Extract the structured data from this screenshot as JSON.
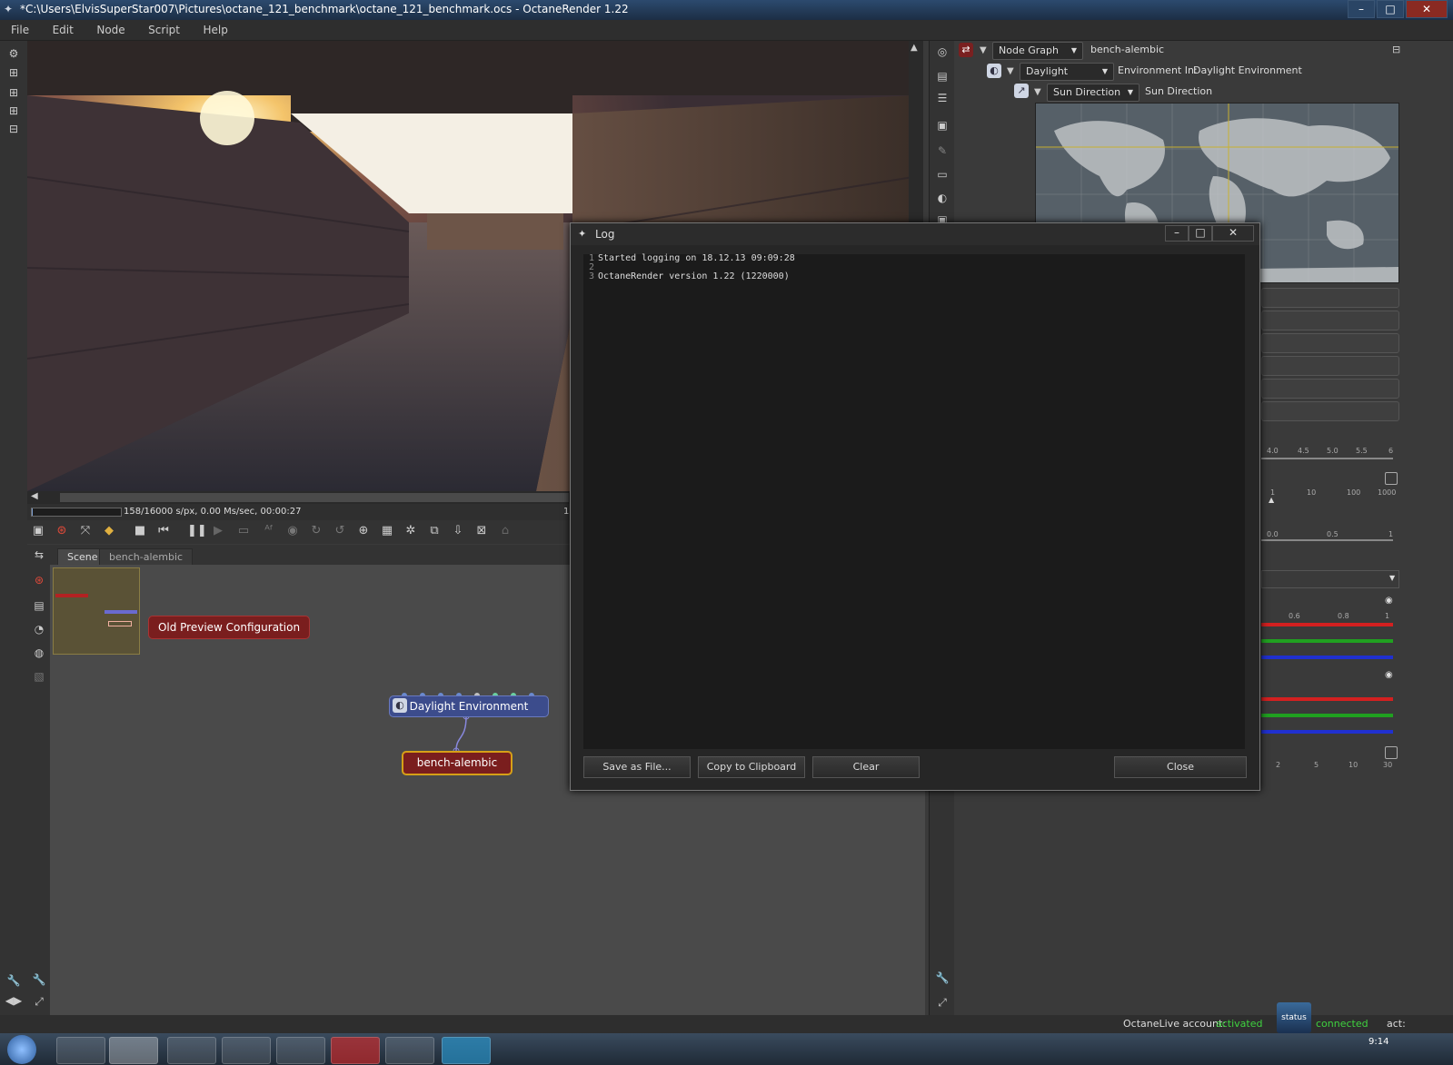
{
  "window": {
    "title": "*C:\\Users\\ElvisSuperStar007\\Pictures\\octane_121_benchmark\\octane_121_benchmark.ocs - OctaneRender 1.22",
    "min": "–",
    "max": "□",
    "close": "✕"
  },
  "menu": [
    "File",
    "Edit",
    "Node",
    "Script",
    "Help"
  ],
  "render_status": {
    "stats": "158/16000 s/px, 0.00 Ms/sec, 00:00:27",
    "progress_fraction": 0.0099,
    "right_marker": "1"
  },
  "node_graph": {
    "tabs": [
      "Scene",
      "bench-alembic"
    ],
    "nodes": {
      "old_preview": "Old Preview Configuration",
      "daylight": "Daylight Environment",
      "bench": "bench-alembic"
    }
  },
  "right_panel": {
    "header_combo": "Node Graph",
    "header_value": "bench-alembic",
    "env_combo": "Daylight",
    "env_label": "Environment In:",
    "env_value": "Daylight Environment",
    "sun_combo": "Sun Direction",
    "sun_label": "Sun Direction",
    "slider_ticks": {
      "s1": [
        "4.0",
        "4.5",
        "5.0",
        "5.5",
        "6"
      ],
      "s2": [
        "1",
        "10",
        "100",
        "1000"
      ],
      "s3": [
        "0.0",
        "0.5",
        "1"
      ],
      "rgb1": [
        "0.6",
        "0.8",
        "1"
      ],
      "last": [
        "2",
        "5",
        "10",
        "30"
      ]
    }
  },
  "log": {
    "title": "Log",
    "lines": [
      {
        "n": "1",
        "text": "Started logging on 18.12.13 09:09:28"
      },
      {
        "n": "2",
        "text": ""
      },
      {
        "n": "3",
        "text": "OctaneRender version 1.22 (1220000)"
      }
    ],
    "buttons": {
      "save": "Save as File...",
      "copy": "Copy to Clipboard",
      "clear": "Clear",
      "close": "Close"
    }
  },
  "status_bar": {
    "account_label": "OctaneLive account:",
    "account_value": "activated",
    "connection_value": "connected",
    "act_label": "act:",
    "status_badge": "status",
    "clock": "9:14"
  },
  "colors": {
    "accent_green": "#3fd23f",
    "node_red": "#7a1e1e",
    "node_blue": "#3c4c8c",
    "node_gold": "#d6a017"
  }
}
